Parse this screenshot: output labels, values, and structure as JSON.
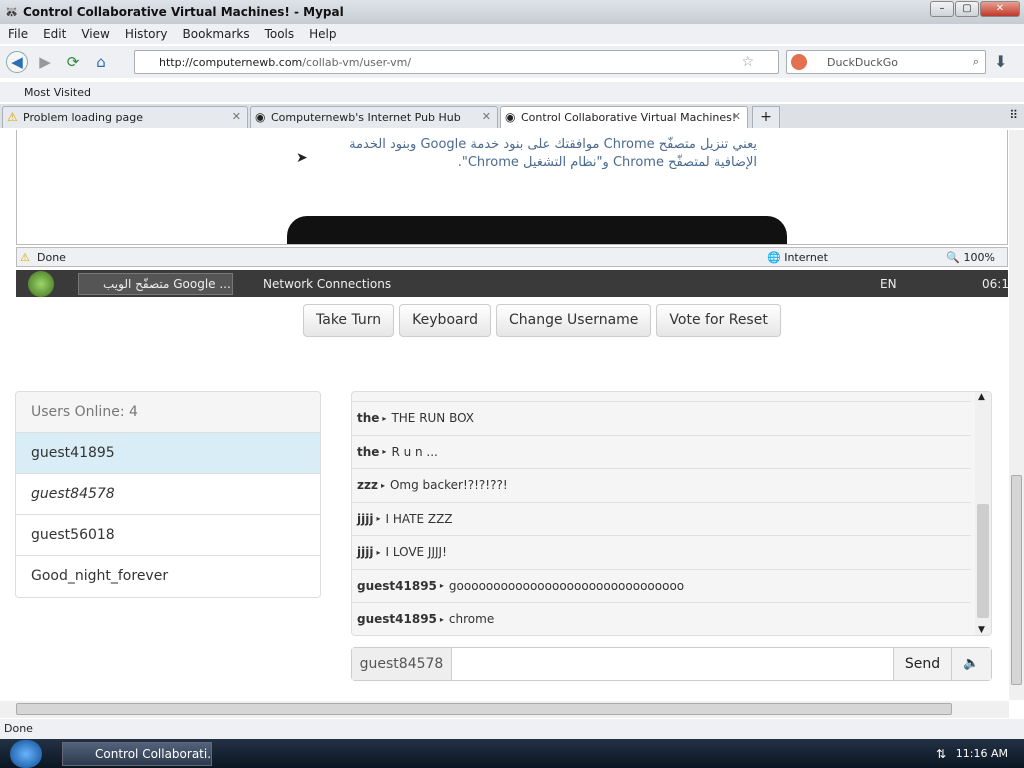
{
  "window": {
    "title": "Control Collaborative Virtual Machines! - Mypal"
  },
  "menu": [
    "File",
    "Edit",
    "View",
    "History",
    "Bookmarks",
    "Tools",
    "Help"
  ],
  "nav": {
    "url_host": "http://computernewb.com",
    "url_path": "/collab-vm/user-vm/",
    "search_placeholder": "DuckDuckGo"
  },
  "bookmarks": {
    "most_visited": "Most Visited"
  },
  "tabs": [
    {
      "label": "Problem loading page"
    },
    {
      "label": "Computernewb's Internet Pub Hub"
    },
    {
      "label": "Control Collaborative Virtual Machines!"
    }
  ],
  "vm_page": {
    "arabic_line1": "يعني تنزيل متصفّح Chrome موافقتك على بنود خدمة Google وبنود الخدمة",
    "arabic_line2": "الإضافية لمتصفّح Chrome و\"نظام التشغيل Chrome\"."
  },
  "vm_ie_status": {
    "done": "Done",
    "zone": "Internet",
    "zoom": "100%"
  },
  "vm_taskbar": {
    "task1": "متصفّح الويب Google ...",
    "task2": "Network Connections",
    "lang": "EN",
    "clock": "06:1"
  },
  "controls": {
    "take_turn": "Take Turn",
    "keyboard": "Keyboard",
    "change_username": "Change Username",
    "vote_reset": "Vote for Reset"
  },
  "users": {
    "header": "Users Online: 4",
    "list": [
      "guest41895",
      "guest84578",
      "guest56018",
      "Good_night_forever"
    ]
  },
  "chat": {
    "messages": [
      {
        "user": "the",
        "text": "THE RUN BOX"
      },
      {
        "user": "the",
        "text": "R u n ..."
      },
      {
        "user": "zzz",
        "text": "Omg backer!?!?!??!"
      },
      {
        "user": "jjjj",
        "text": "I HATE ZZZ"
      },
      {
        "user": "jjjj",
        "text": "I LOVE JJJJ!"
      },
      {
        "user": "guest41895",
        "text": "gooooooooooooooooooooooooooooooo"
      },
      {
        "user": "guest41895",
        "text": "chrome"
      }
    ],
    "username": "guest84578",
    "send": "Send"
  },
  "statusbar": {
    "text": "Done"
  },
  "os_taskbar": {
    "task": "Control Collaborati...",
    "clock": "11:16 AM"
  }
}
